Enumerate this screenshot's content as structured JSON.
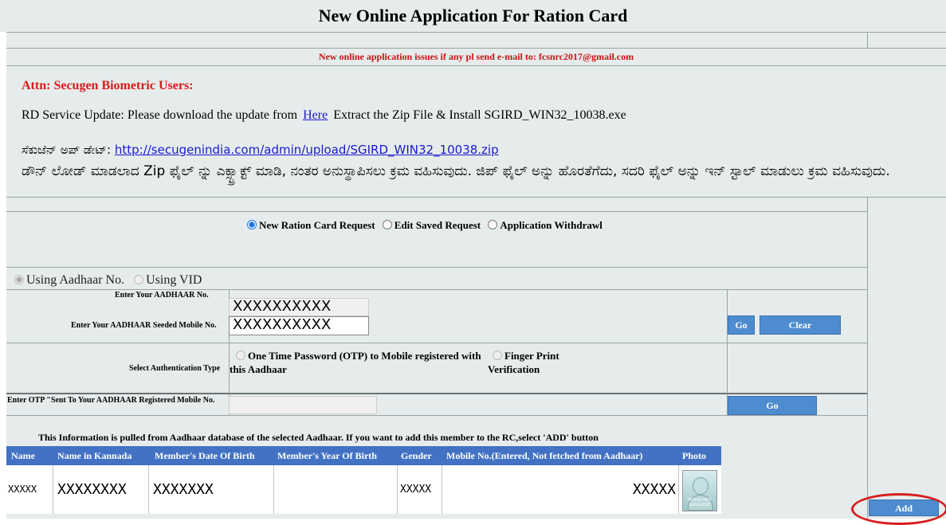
{
  "title": "New Online Application For Ration Card",
  "notice": "New online application issues if any pl send e-mail to: fcsnrc2017@gmail.com",
  "attention": {
    "heading": "Attn: Secugen Biometric Users:",
    "rd_prefix": "RD Service Update: Please download the update from",
    "rd_link": "Here",
    "rd_suffix": "Extract the Zip File & Install SGIRD_WIN32_10038.exe",
    "kn_label": "ಸೆಕುಜೆನ್ ಅಪ್ ಡೇಟ್:",
    "kn_link": "http://secugenindia.com/admin/upload/SGIRD_WIN32_10038.zip",
    "kn_instructions": "ಡೌನ್ ಲೋಡ್ ಮಾಡಲಾದ Zip ಫೈಲ್ ನ್ನು ಎಕ್ಸ್ಟ್ರಾಕ್ಟ್ ಮಾಡಿ, ನಂತರ ಅನುಸ್ಥಾಪಿಸಲು ಕ್ರಮ ವಹಿಸುವುದು. ಜಿಪ್ ಫೈಲ್ ಅನ್ನು ಹೊರತೆಗೆದು, ಸದರಿ ಫೈಲ್ ಅನ್ನು ಇನ್ ಸ್ಟಾಲ್ ಮಾಡುಲು ಕ್ರಮ ವಹಿಸುವುದು."
  },
  "request_options": {
    "new": "New Ration Card Request",
    "edit": "Edit Saved Request",
    "withdraw": "Application Withdrawl",
    "selected": "new"
  },
  "id_options": {
    "aadhaar": "Using Aadhaar No.",
    "vid": "Using VID",
    "selected": "aadhaar"
  },
  "form": {
    "aadhaar_label": "Enter Your AADHAAR No.",
    "aadhaar_value": "XXXXXXXXXX",
    "mobile_label": "Enter Your AADHAAR Seeded Mobile No.",
    "mobile_value": "XXXXXXXXXX",
    "go_label": "Go",
    "clear_label": "Clear",
    "auth_label": "Select Authentication Type",
    "auth_otp": "One Time Password (OTP) to Mobile registered with this Aadhaar",
    "auth_fp": "Finger Print Verification",
    "otp_label": "Enter OTP \"Sent To Your AADHAAR Registered Mobile No.",
    "otp_value": "",
    "otp_go_label": "Go"
  },
  "member_table": {
    "info": "This Information is pulled from Aadhaar database of the selected Aadhaar. If you want to add this member to the RC,select 'ADD' button",
    "headers": [
      "Name",
      "Name in Kannada",
      "Member's Date Of Birth",
      "Member's Year Of Birth",
      "Gender",
      "Mobile No.(Entered, Not fetched from Aadhaar)",
      "Photo"
    ],
    "row": [
      "XXXXX",
      "XXXXXXXX",
      "XXXXXXX",
      "",
      "XXXXX",
      "XXXXX"
    ],
    "photo_text": "PHOTO NOT AVAILABLE",
    "add_label": "Add"
  },
  "colors": {
    "panel": "#e6ecec",
    "header_blue": "#4372c4",
    "button_blue": "#4e8cd0",
    "alert_red": "#d81a1a",
    "highlight_circle": "#d81d1d"
  }
}
